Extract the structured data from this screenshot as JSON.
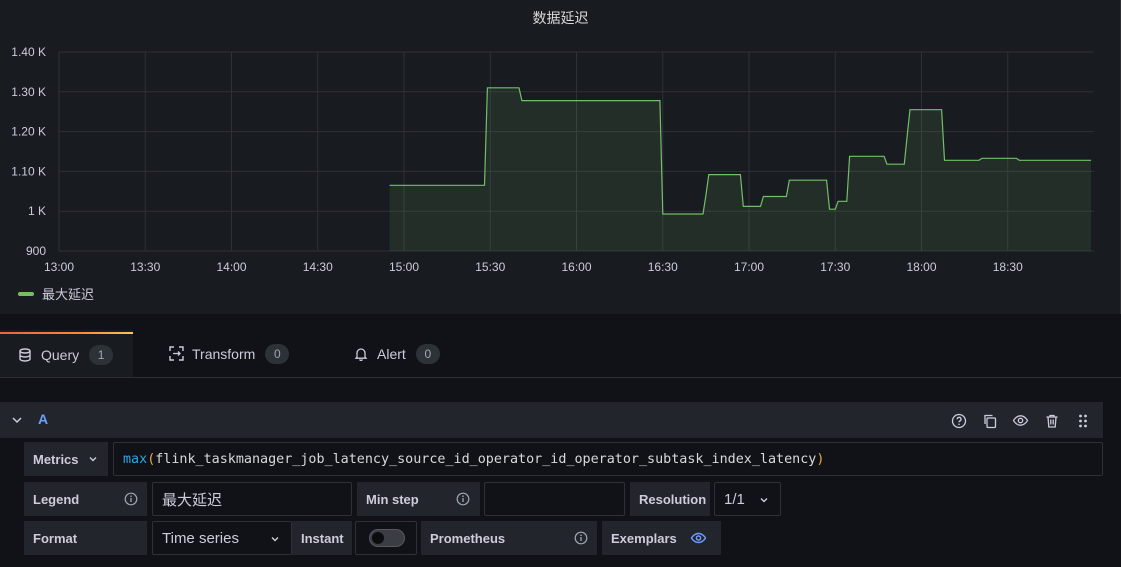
{
  "panel": {
    "title": "数据延迟",
    "legend": "最大延迟"
  },
  "chart_data": {
    "type": "area",
    "title": "数据延迟",
    "x_ticks": [
      "13:00",
      "13:30",
      "14:00",
      "14:30",
      "15:00",
      "15:30",
      "16:00",
      "16:30",
      "17:00",
      "17:30",
      "18:00",
      "18:30"
    ],
    "y_ticks": [
      "900",
      "1 K",
      "1.10 K",
      "1.20 K",
      "1.30 K",
      "1.40 K"
    ],
    "ylim": [
      900,
      1400
    ],
    "xlim": [
      "13:00",
      "19:00"
    ],
    "series": [
      {
        "name": "最大延迟",
        "color": "#73bf69",
        "points": [
          [
            "14:55",
            1065
          ],
          [
            "15:28",
            1065
          ],
          [
            "15:29",
            1310
          ],
          [
            "15:40",
            1310
          ],
          [
            "15:41",
            1278
          ],
          [
            "16:29",
            1278
          ],
          [
            "16:30",
            993
          ],
          [
            "16:44",
            993
          ],
          [
            "16:45",
            1040
          ],
          [
            "16:46",
            1092
          ],
          [
            "16:57",
            1092
          ],
          [
            "16:58",
            1012
          ],
          [
            "17:04",
            1012
          ],
          [
            "17:05",
            1037
          ],
          [
            "17:13",
            1037
          ],
          [
            "17:14",
            1078
          ],
          [
            "17:27",
            1078
          ],
          [
            "17:28",
            1005
          ],
          [
            "17:30",
            1005
          ],
          [
            "17:31",
            1025
          ],
          [
            "17:34",
            1025
          ],
          [
            "17:35",
            1138
          ],
          [
            "17:47",
            1138
          ],
          [
            "17:48",
            1118
          ],
          [
            "17:54",
            1118
          ],
          [
            "17:55",
            1188
          ],
          [
            "17:56",
            1255
          ],
          [
            "18:07",
            1255
          ],
          [
            "18:08",
            1128
          ],
          [
            "18:20",
            1128
          ],
          [
            "18:21",
            1133
          ],
          [
            "18:33",
            1133
          ],
          [
            "18:34",
            1128
          ],
          [
            "18:59",
            1128
          ]
        ]
      }
    ],
    "grid": true,
    "legend_position": "bottom-left"
  },
  "tabs": [
    {
      "label": "Query",
      "count": "1",
      "icon": "database-icon"
    },
    {
      "label": "Transform",
      "count": "0",
      "icon": "transform-icon"
    },
    {
      "label": "Alert",
      "count": "0",
      "icon": "bell-icon"
    }
  ],
  "query": {
    "ref_id": "A",
    "metrics_label": "Metrics",
    "expr_fn": "max",
    "expr_open": "(",
    "expr_metric": "flink_taskmanager_job_latency_source_id_operator_id_operator_subtask_index_latency",
    "expr_close": ")",
    "legend_label": "Legend",
    "legend_value": "最大延迟",
    "min_step_label": "Min step",
    "min_step_value": "",
    "resolution_label": "Resolution",
    "resolution_value": "1/1",
    "format_label": "Format",
    "format_value": "Time series",
    "instant_label": "Instant",
    "prometheus_label": "Prometheus",
    "exemplars_label": "Exemplars"
  }
}
